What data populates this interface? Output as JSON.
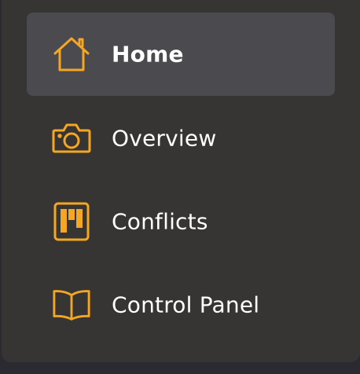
{
  "colors": {
    "accent": "#f5a623",
    "panel_bg": "#363533",
    "active_bg": "#4b4b4f",
    "text": "#ffffff"
  },
  "nav": {
    "items": [
      {
        "label": "Home",
        "icon": "home-icon",
        "active": true
      },
      {
        "label": "Overview",
        "icon": "camera-icon",
        "active": false
      },
      {
        "label": "Conflicts",
        "icon": "kanban-board-icon",
        "active": false
      },
      {
        "label": "Control Panel",
        "icon": "open-book-icon",
        "active": false
      }
    ]
  }
}
